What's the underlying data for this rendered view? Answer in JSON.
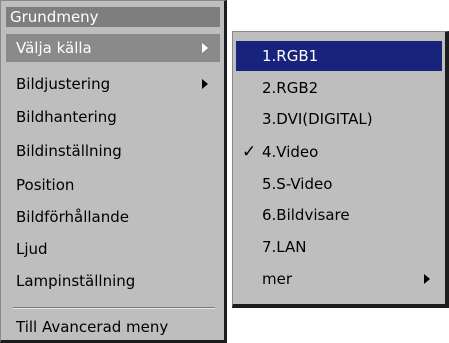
{
  "main_menu": {
    "title": "Grundmeny",
    "items": [
      {
        "label": "Välja källa"
      },
      {
        "label": "Bildjustering"
      },
      {
        "label": "Bildhantering"
      },
      {
        "label": "Bildinställning"
      },
      {
        "label": "Position"
      },
      {
        "label": "Bildförhållande"
      },
      {
        "label": "Ljud"
      },
      {
        "label": "Lampinställning"
      },
      {
        "label": "Till Avancerad meny"
      }
    ]
  },
  "source_submenu": {
    "items": [
      {
        "label": "1.RGB1"
      },
      {
        "label": "2.RGB2"
      },
      {
        "label": "3.DVI(DIGITAL)"
      },
      {
        "label": "4.Video"
      },
      {
        "label": "5.S-Video"
      },
      {
        "label": "6.Bildvisare"
      },
      {
        "label": "7.LAN"
      },
      {
        "label": "mer"
      }
    ],
    "highlighted_color": "#18237c",
    "checked_glyph": "✓"
  }
}
